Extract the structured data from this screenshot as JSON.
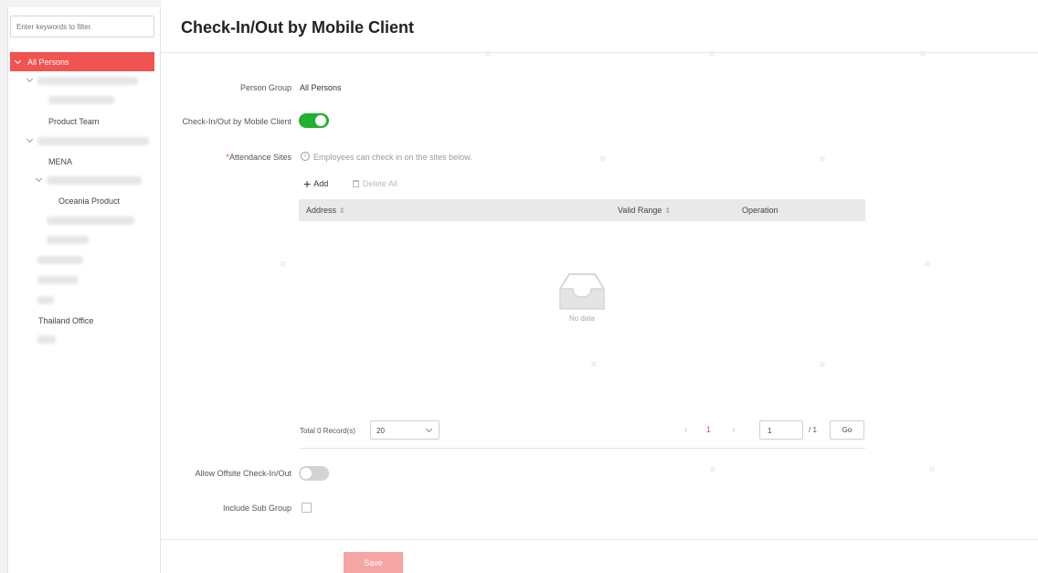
{
  "sidebar": {
    "filter_placeholder": "Enter keywords to filter.",
    "selected_label": "All Persons",
    "visible_items": [
      "Product Team",
      "MENA",
      "Oceania Product",
      "Thailand Office"
    ]
  },
  "header": {
    "title": "Check-In/Out by Mobile Client"
  },
  "form": {
    "person_group_label": "Person Group",
    "person_group_value": "All Persons",
    "mobile_checkin_label": "Check-In/Out by Mobile Client",
    "mobile_checkin_enabled": true,
    "attendance_sites_required": "*",
    "attendance_sites_label": "Attendance Sites",
    "attendance_sites_hint": "Employees can check in on the sites below.",
    "add_label": "Add",
    "delete_all_label": "Delete All",
    "table": {
      "columns": [
        "Address",
        "Valid Range",
        "Operation"
      ],
      "sort_glyph": "⇕",
      "empty_text": "No data"
    },
    "pagination": {
      "total_text": "Total 0 Record(s)",
      "page_size": "20",
      "current_page": "1",
      "page_input": "1",
      "page_total": "/ 1",
      "go_label": "Go"
    },
    "allow_offsite_label": "Allow Offsite Check-In/Out",
    "allow_offsite_enabled": false,
    "include_sub_group_label": "Include Sub Group",
    "include_sub_group_checked": false
  },
  "footer": {
    "save_label": "Save"
  },
  "colors": {
    "accent": "#f15350",
    "toggle_on": "#21b131",
    "save_disabled": "#f5a5a3"
  }
}
